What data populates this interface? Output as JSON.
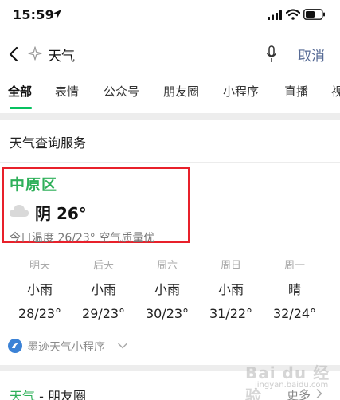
{
  "status_bar": {
    "time": "15:59"
  },
  "search": {
    "query": "天气",
    "cancel_label": "取消"
  },
  "tabs": [
    {
      "label": "全部",
      "active": true
    },
    {
      "label": "表情"
    },
    {
      "label": "公众号"
    },
    {
      "label": "朋友圈"
    },
    {
      "label": "小程序"
    },
    {
      "label": "直播"
    },
    {
      "label": "视"
    }
  ],
  "weather_card": {
    "service_title": "天气查询服务",
    "district": "中原区",
    "condition_icon": "cloud-icon",
    "condition": "阴 26°",
    "summary": "今日温度 26/23° 空气质量优",
    "forecast": [
      {
        "day": "明天",
        "condition": "小雨",
        "temp": "28/23°"
      },
      {
        "day": "后天",
        "condition": "小雨",
        "temp": "29/23°"
      },
      {
        "day": "周六",
        "condition": "小雨",
        "temp": "30/23°"
      },
      {
        "day": "周日",
        "condition": "小雨",
        "temp": "31/22°"
      },
      {
        "day": "周一",
        "condition": "晴",
        "temp": "32/24°"
      }
    ],
    "mini_program_label": "墨迹天气小程序"
  },
  "friends_section": {
    "keyword": "天气",
    "title_suffix": " - 朋友圈",
    "more_label": "更多"
  },
  "watermark": {
    "text": "Bai du 经验",
    "sub": "jingyan.baidu.com"
  },
  "colors": {
    "accent_green": "#07c160",
    "district_green": "#2fb05a",
    "link_blue": "#576b95",
    "highlight_red": "#e8202a"
  }
}
